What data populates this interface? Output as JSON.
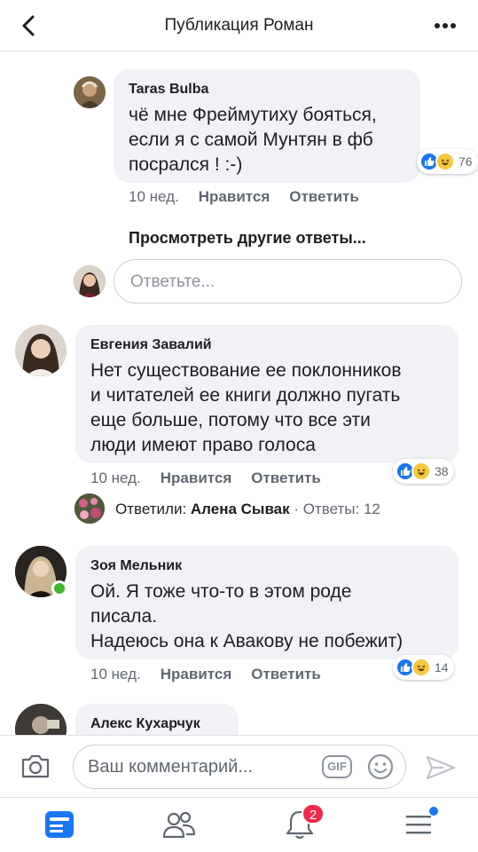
{
  "header": {
    "title": "Публикация Роман"
  },
  "comments": [
    {
      "author": "Taras Bulba",
      "lines": [
        "чё мне Фреймутиху бояться,",
        "если я с самой Мунтян  в фб",
        "посрался !  :-)"
      ],
      "time": "10 нед.",
      "like_label": "Нравится",
      "reply_label": "Ответить",
      "reaction_count": "76"
    },
    {
      "author": "Евгения Завалий",
      "lines": [
        "Нет существование ее поклонников",
        "и читателей ее книги должно пугать",
        "еще больше, потому что все эти",
        "люди имеют право голоса"
      ],
      "time": "10 нед.",
      "like_label": "Нравится",
      "reply_label": "Ответить",
      "reaction_count": "38"
    },
    {
      "author": "Зоя Мельник",
      "lines": [
        "Ой. Я тоже что-то в этом роде",
        "писала.",
        "Надеюсь она к Авакову не побежит)"
      ],
      "time": "10 нед.",
      "like_label": "Нравится",
      "reply_label": "Ответить",
      "reaction_count": "14"
    },
    {
      "author": "Алекс Кухарчук"
    }
  ],
  "view_more_replies": "Просмотреть другие ответы...",
  "reply_input": {
    "placeholder": "Ответьте..."
  },
  "replied_summary": {
    "prefix": "Ответили: ",
    "name": "Алена Сывак",
    "count": " · Ответы: 12"
  },
  "composer": {
    "placeholder": "Ваш комментарий...",
    "gif_label": "GIF"
  },
  "tabbar": {
    "notifications_badge": "2"
  },
  "colors": {
    "accent": "#1877f2",
    "bubble": "#f0f2f5",
    "badge": "#f02849",
    "online": "#42b72a"
  }
}
